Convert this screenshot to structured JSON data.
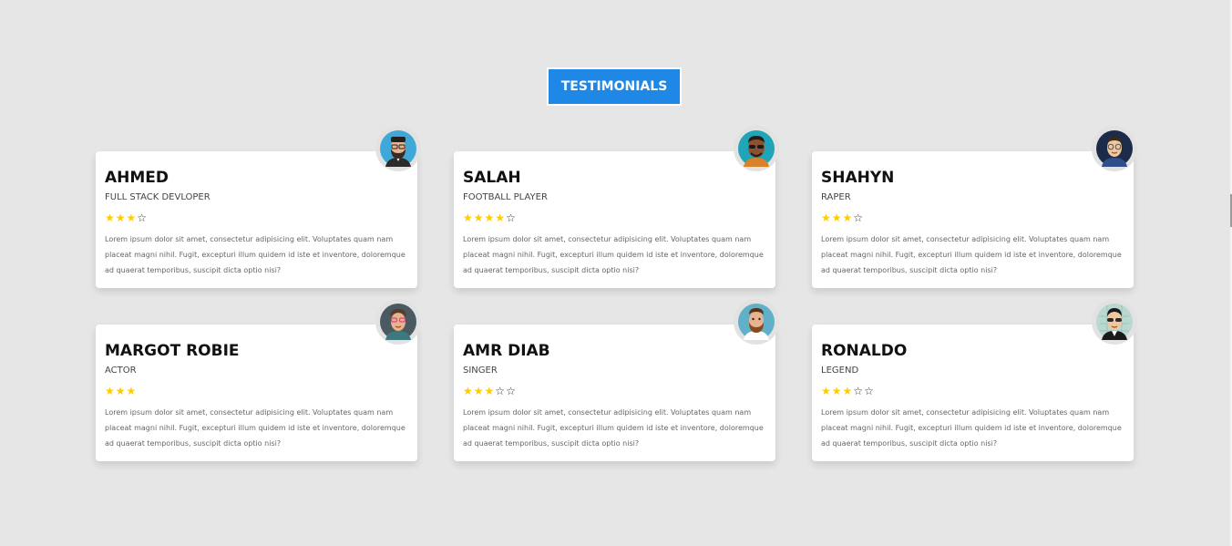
{
  "header": {
    "title": "TESTIMONIALS"
  },
  "colors": {
    "background": "#e6e6e6",
    "accent": "#1f87e5",
    "star": "#ffcc00"
  },
  "testimonials": [
    {
      "name": "AHMED",
      "role": "FULL STACK DEVLOPER",
      "rating": 3,
      "stars_shown": 4,
      "text": "Lorem ipsum dolor sit amet, consectetur adipisicing elit. Voluptates quam nam placeat magni nihil. Fugit, excepturi illum quidem id iste et inventore, doloremque ad quaerat temporibus, suscipit dicta optio nisi?",
      "avatar": "avatar-bearded-cap-icon"
    },
    {
      "name": "SALAH",
      "role": "FOOTBALL PLAYER",
      "rating": 4,
      "stars_shown": 5,
      "text": "Lorem ipsum dolor sit amet, consectetur adipisicing elit. Voluptates quam nam placeat magni nihil. Fugit, excepturi illum quidem id iste et inventore, doloremque ad quaerat temporibus, suscipit dicta optio nisi?",
      "avatar": "avatar-sunglasses-icon"
    },
    {
      "name": "SHAHYN",
      "role": "RAPER",
      "rating": 3,
      "stars_shown": 4,
      "text": "Lorem ipsum dolor sit amet, consectetur adipisicing elit. Voluptates quam nam placeat magni nihil. Fugit, excepturi illum quidem id iste et inventore, doloremque ad quaerat temporibus, suscipit dicta optio nisi?",
      "avatar": "avatar-glasses-icon"
    },
    {
      "name": "MARGOT ROBIE",
      "role": "ACTOR",
      "rating": 3,
      "stars_shown": 3,
      "text": "Lorem ipsum dolor sit amet, consectetur adipisicing elit. Voluptates quam nam placeat magni nihil. Fugit, excepturi illum quidem id iste et inventore, doloremque ad quaerat temporibus, suscipit dicta optio nisi?",
      "avatar": "avatar-pink-glasses-icon"
    },
    {
      "name": "AMR DIAB",
      "role": "SINGER",
      "rating": 3,
      "stars_shown": 5,
      "text": "Lorem ipsum dolor sit amet, consectetur adipisicing elit. Voluptates quam nam placeat magni nihil. Fugit, excepturi illum quidem id iste et inventore, doloremque ad quaerat temporibus, suscipit dicta optio nisi?",
      "avatar": "avatar-beard-icon"
    },
    {
      "name": "RONALDO",
      "role": "LEGEND",
      "rating": 3,
      "stars_shown": 5,
      "text": "Lorem ipsum dolor sit amet, consectetur adipisicing elit. Voluptates quam nam placeat magni nihil. Fugit, excepturi illum quidem id iste et inventore, doloremque ad quaerat temporibus, suscipit dicta optio nisi?",
      "avatar": "avatar-aviator-icon"
    }
  ]
}
